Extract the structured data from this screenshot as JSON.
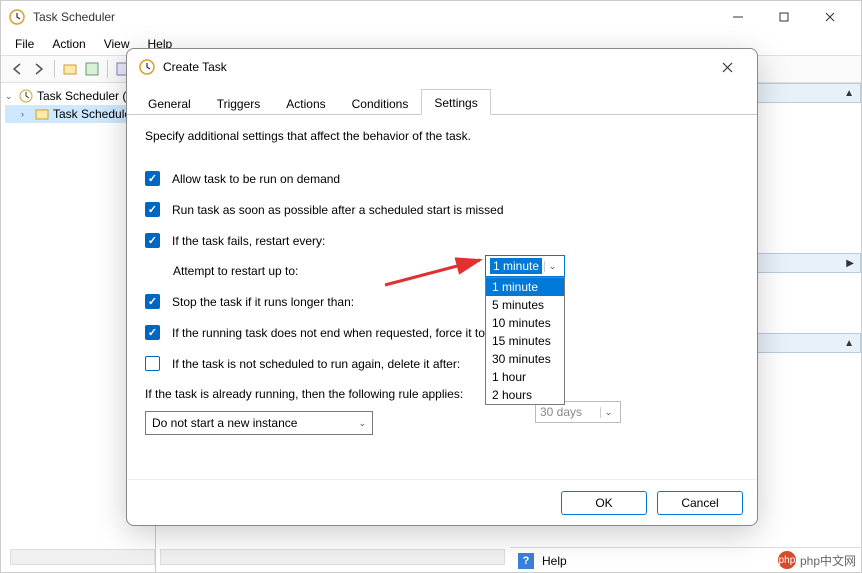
{
  "main_window": {
    "title": "Task Scheduler",
    "menu": {
      "file": "File",
      "action": "Action",
      "view": "View",
      "help": "Help"
    },
    "tree": {
      "root": "Task Scheduler (L",
      "child": "Task Schedule"
    },
    "help_label": "Help"
  },
  "dialog": {
    "title": "Create Task",
    "tabs": {
      "general": "General",
      "triggers": "Triggers",
      "actions": "Actions",
      "conditions": "Conditions",
      "settings": "Settings"
    },
    "desc": "Specify additional settings that affect the behavior of the task.",
    "settings": {
      "allow_demand": "Allow task to be run on demand",
      "run_asap": "Run task as soon as possible after a scheduled start is missed",
      "restart_every": "If the task fails, restart every:",
      "attempt_restart": "Attempt to restart up to:",
      "stop_longer": "Stop the task if it runs longer than:",
      "force_stop": "If the running task does not end when requested, force it to st",
      "delete_after": "If the task is not scheduled to run again, delete it after:",
      "rule_applies": "If the task is already running, then the following rule applies:"
    },
    "combos": {
      "restart_value": "1 minute",
      "delete_after_value": "30 days",
      "rule_value": "Do not start a new instance"
    },
    "dropdown_options": [
      "1 minute",
      "5 minutes",
      "10 minutes",
      "15 minutes",
      "30 minutes",
      "1 hour",
      "2 hours"
    ],
    "buttons": {
      "ok": "OK",
      "cancel": "Cancel"
    }
  },
  "watermark": "php中文网"
}
